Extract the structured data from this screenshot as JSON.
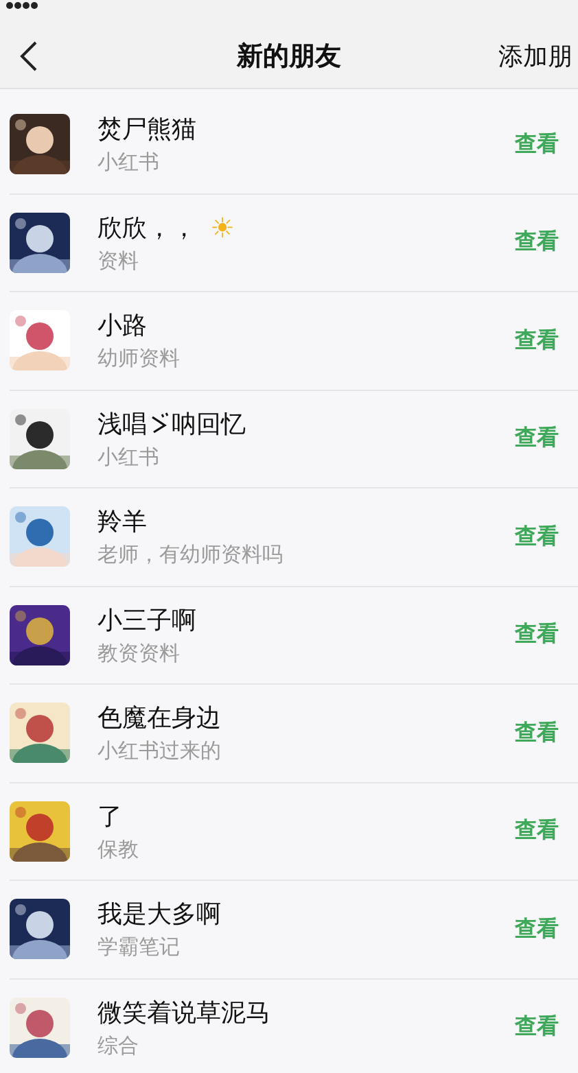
{
  "nav": {
    "title": "新的朋友",
    "action": "添加朋"
  },
  "friends": [
    {
      "name": "焚尸熊猫",
      "message": "小红书",
      "action": "查看"
    },
    {
      "name": "欣欣，，",
      "emoji": "☀",
      "message": "资料",
      "action": "查看"
    },
    {
      "name": "小路",
      "message": "幼师资料",
      "action": "查看"
    },
    {
      "name_parts": [
        "浅唱",
        "呐回忆"
      ],
      "message": "小红书",
      "action": "查看"
    },
    {
      "name": "羚羊",
      "message": "老师，有幼师资料吗",
      "action": "查看"
    },
    {
      "name": "小三子啊",
      "message": "教资资料",
      "action": "查看"
    },
    {
      "name": "色魔在身边",
      "message": "小红书过来的",
      "action": "查看"
    },
    {
      "name": "了",
      "message": "保教",
      "action": "查看"
    },
    {
      "name": "我是大多啊",
      "message": "学霸笔记",
      "action": "查看"
    },
    {
      "name": "微笑着说草泥马",
      "message": "综合",
      "action": "查看"
    }
  ]
}
